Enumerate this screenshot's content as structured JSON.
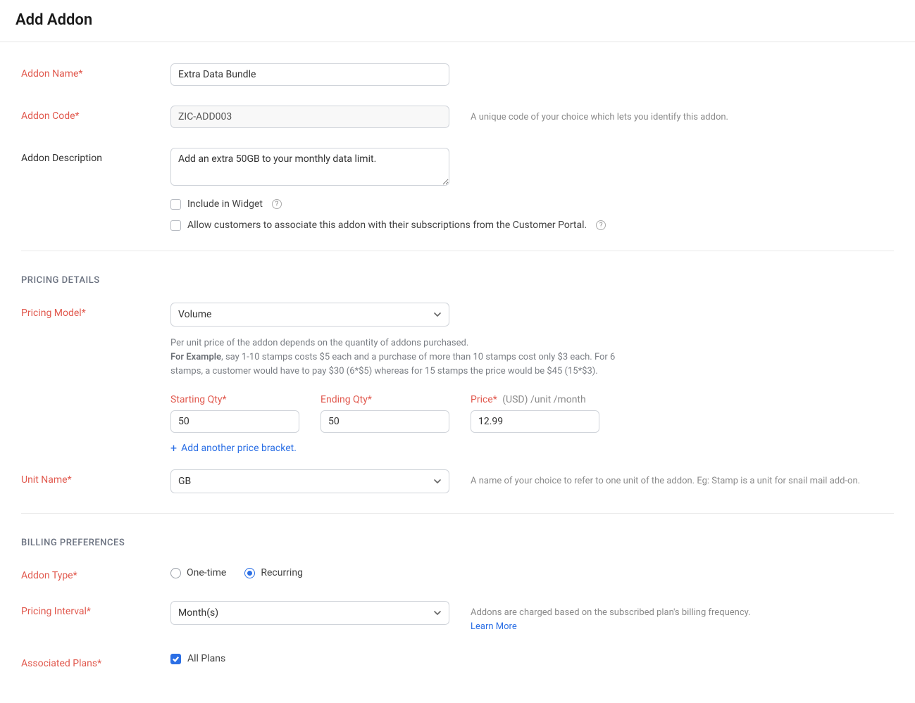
{
  "header": {
    "title": "Add Addon"
  },
  "labels": {
    "addon_name": "Addon Name*",
    "addon_code": "Addon Code*",
    "addon_desc": "Addon Description",
    "pricing_model": "Pricing Model*",
    "starting_qty": "Starting Qty*",
    "ending_qty": "Ending Qty*",
    "price": "Price*",
    "price_unit": "(USD) /unit /month",
    "unit_name": "Unit Name*",
    "addon_type": "Addon Type*",
    "pricing_interval": "Pricing Interval*",
    "associated_plans": "Associated Plans*"
  },
  "fields": {
    "addon_name": "Extra Data Bundle",
    "addon_code": "ZIC-ADD003",
    "addon_desc": "Add an extra 50GB to your monthly data limit.",
    "pricing_model": "Volume",
    "starting_qty": "50",
    "ending_qty": "50",
    "price": "12.99",
    "unit_name": "GB",
    "pricing_interval": "Month(s)"
  },
  "checkboxes": {
    "include_widget": "Include in Widget",
    "allow_portal": "Allow customers to associate this addon with their subscriptions from the Customer Portal.",
    "all_plans": "All Plans"
  },
  "hints": {
    "addon_code": "A unique code of your choice which lets you identify this addon.",
    "pricing_desc_line1": "Per unit price of the addon depends on the quantity of addons purchased.",
    "pricing_desc_bold": "For Example",
    "pricing_desc_cont": ", say 1-10 stamps costs $5 each and a purchase of more than 10 stamps cost only $3 each. For 6 stamps, a customer would have to pay $30 (6*$5) whereas for 15 stamps the price would be $45 (15*$3).",
    "unit_name": "A name of your choice to refer to one unit of the addon. Eg: Stamp is a unit for snail mail add-on.",
    "interval": "Addons are charged based on the subscribed plan's billing frequency.",
    "learn_more": "Learn More"
  },
  "sections": {
    "pricing": "PRICING DETAILS",
    "billing": "BILLING PREFERENCES"
  },
  "actions": {
    "add_bracket": "Add another price bracket."
  },
  "radios": {
    "one_time": "One-time",
    "recurring": "Recurring"
  }
}
